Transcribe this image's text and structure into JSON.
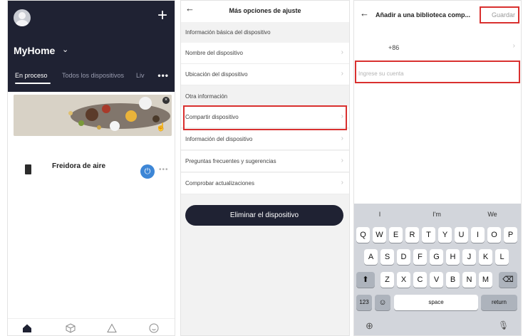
{
  "panel1": {
    "plus_label": "+",
    "home_title": "MyHome",
    "home_caret": "⌄",
    "tabs": [
      "En proceso",
      "Todos los dispositivos",
      "Liv"
    ],
    "more_label": "•••",
    "device_name": "Freidora de aire",
    "power_symbol": "⏻",
    "device_more": "•••",
    "banner_close": "×",
    "banner_hand": "☝",
    "nav_icons": [
      "home-icon",
      "device-cube-icon",
      "scene-icon",
      "profile-icon"
    ]
  },
  "panel2": {
    "back_label": "←",
    "title": "Más opciones de ajuste",
    "section_basic": "Información básica del dispositivo",
    "basic_rows": [
      "Nombre del dispositivo",
      "Ubicación del dispositivo"
    ],
    "section_other": "Otra información",
    "other_rows": [
      "Compartir dispositivo",
      "Información del dispositivo",
      "Preguntas frecuentes y sugerencias",
      "Comprobar actualizaciones"
    ],
    "chevron": "›",
    "delete_label": "Eliminar el dispositivo"
  },
  "panel3": {
    "back_label": "←",
    "title": "Añadir a una biblioteca comp...",
    "save_label": "Guardar",
    "phone_code": "+86",
    "chevron": "›",
    "account_placeholder": "Ingrese su cuenta",
    "suggestions": [
      "I",
      "I'm",
      "We"
    ],
    "row1": [
      "Q",
      "W",
      "E",
      "R",
      "T",
      "Y",
      "U",
      "I",
      "O",
      "P"
    ],
    "row2": [
      "A",
      "S",
      "D",
      "F",
      "G",
      "H",
      "J",
      "K",
      "L"
    ],
    "row3": [
      "Z",
      "X",
      "C",
      "V",
      "B",
      "N",
      "M"
    ],
    "shift_symbol": "⬆",
    "backspace_symbol": "⌫",
    "key_123": "123",
    "emoji_symbol": "☺",
    "space_label": "space",
    "return_label": "return",
    "globe_symbol": "⊕",
    "mic_symbol": "🎙"
  },
  "colors": {
    "header_dark": "#1f2233",
    "highlight_red": "#d9302f",
    "power_blue": "#3d86d6"
  }
}
